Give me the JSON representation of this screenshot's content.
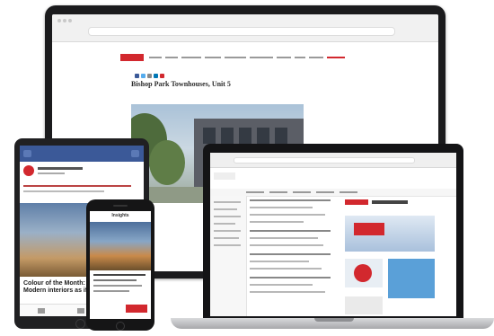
{
  "monitor": {
    "logo_text": "",
    "article_title": "Bishop Park Townhouses, Unit 5"
  },
  "tablet": {
    "header_title": "",
    "caption": "Colour of the Month: Autumn",
    "caption2": "Modern interiors as if"
  },
  "phone": {
    "title": "Insights"
  },
  "colors": {
    "brand_red": "#d2282e",
    "facebook_blue": "#3b5998",
    "device_black": "#1b1b1d"
  }
}
